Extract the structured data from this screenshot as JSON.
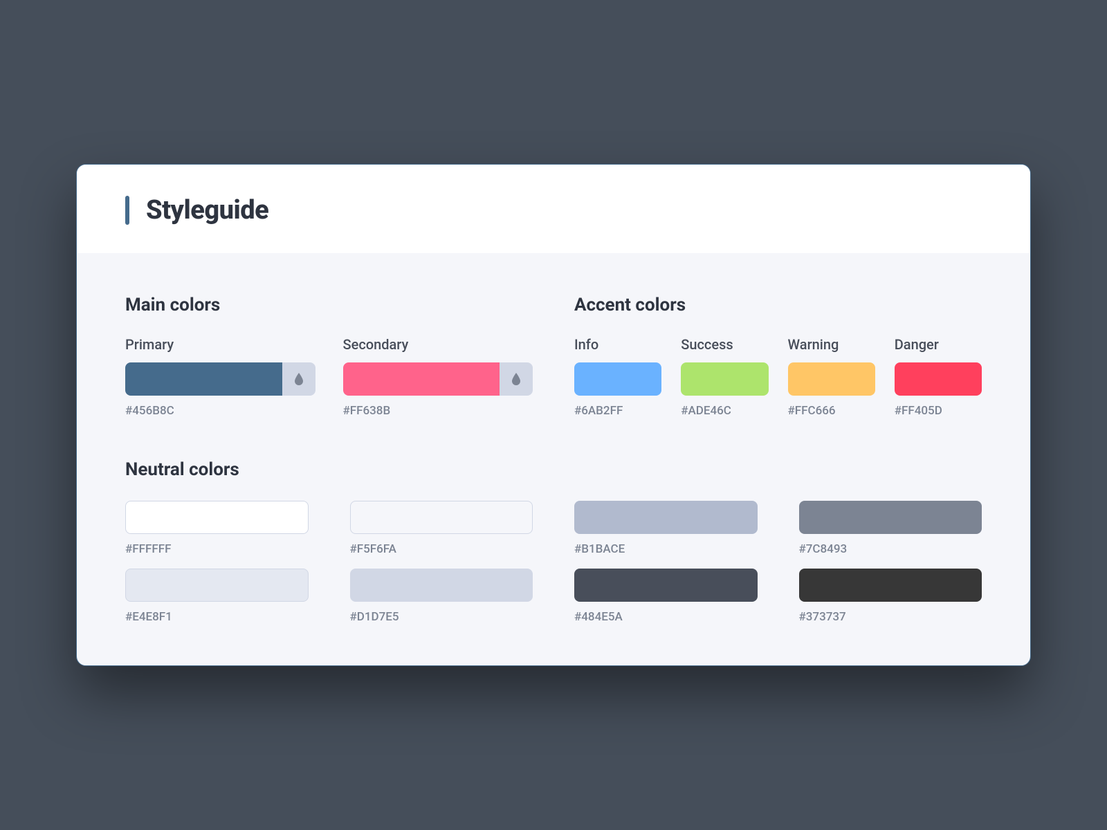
{
  "title": "Styleguide",
  "sections": {
    "main": {
      "title": "Main colors",
      "colors": [
        {
          "label": "Primary",
          "hex": "#456B8C"
        },
        {
          "label": "Secondary",
          "hex": "#FF638B"
        }
      ]
    },
    "accent": {
      "title": "Accent colors",
      "colors": [
        {
          "label": "Info",
          "hex": "#6AB2FF"
        },
        {
          "label": "Success",
          "hex": "#ADE46C"
        },
        {
          "label": "Warning",
          "hex": "#FFC666"
        },
        {
          "label": "Danger",
          "hex": "#FF405D"
        }
      ]
    },
    "neutral": {
      "title": "Neutral colors",
      "colors": [
        {
          "hex": "#FFFFFF"
        },
        {
          "hex": "#F5F6FA"
        },
        {
          "hex": "#B1BACE"
        },
        {
          "hex": "#7C8493"
        },
        {
          "hex": "#E4E8F1"
        },
        {
          "hex": "#D1D7E5"
        },
        {
          "hex": "#484E5A"
        },
        {
          "hex": "#373737"
        }
      ]
    }
  }
}
